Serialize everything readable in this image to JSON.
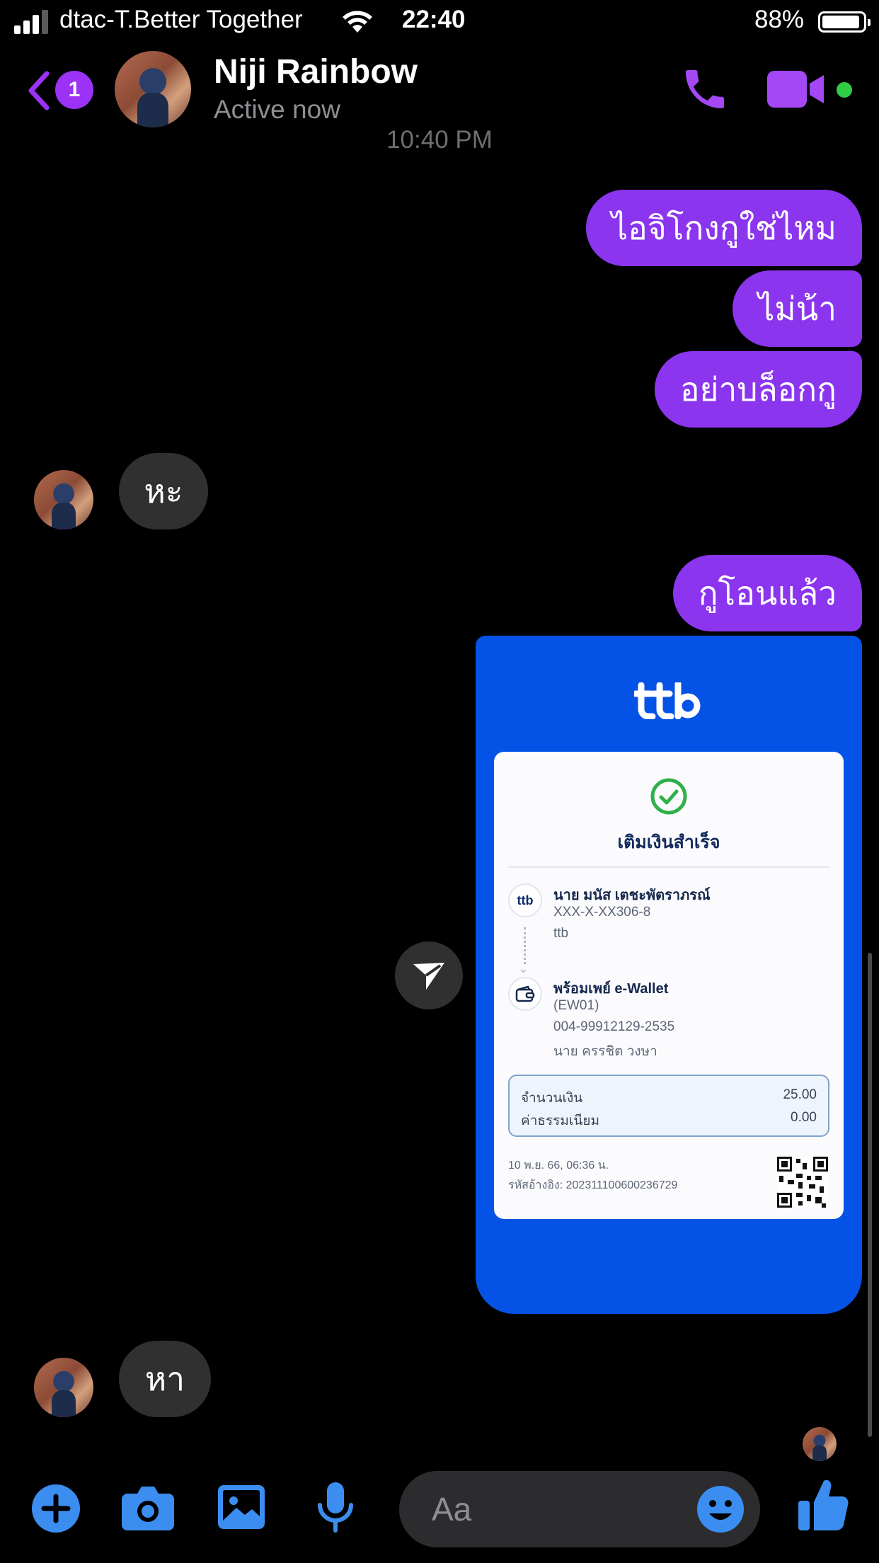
{
  "status_bar": {
    "carrier": "dtac-T.Better Together",
    "time": "22:40",
    "battery": "88%"
  },
  "header": {
    "back_count": "1",
    "contact_name": "Niji Rainbow",
    "contact_status": "Active now",
    "accent_color": "#9b32f6"
  },
  "chat": {
    "timestamp": "10:40 PM",
    "messages": [
      {
        "from": "me",
        "text": "ไอจิโกงกูใช่ไหม"
      },
      {
        "from": "me",
        "text": "ไม่น้า"
      },
      {
        "from": "me",
        "text": "อย่าบล็อกกู"
      },
      {
        "from": "them",
        "text": "หะ"
      },
      {
        "from": "me",
        "text": "กูโอนแล้ว"
      },
      {
        "from": "them",
        "text": "หา"
      }
    ]
  },
  "receipt": {
    "bank_logo": "ttb",
    "title": "เติมเงินสำเร็จ",
    "sender_name": "นาย มนัส เตชะพัตราภรณ์",
    "sender_account": "XXX-X-XX306-8",
    "sender_bank": "ttb",
    "receiver_service": "พร้อมเพย์ e-Wallet",
    "receiver_code": "(EW01)",
    "receiver_account": "004-99912129-2535",
    "receiver_name": "นาย ครรชิต วงษา",
    "amount_label": "จำนวนเงิน",
    "amount_value": "25.00",
    "fee_label": "ค่าธรรมเนียม",
    "fee_value": "0.00",
    "date": "10 พ.ย. 66, 06:36 น.",
    "reference": "รหัสอ้างอิง: 202311100600236729"
  },
  "composer": {
    "placeholder": "Aa"
  }
}
